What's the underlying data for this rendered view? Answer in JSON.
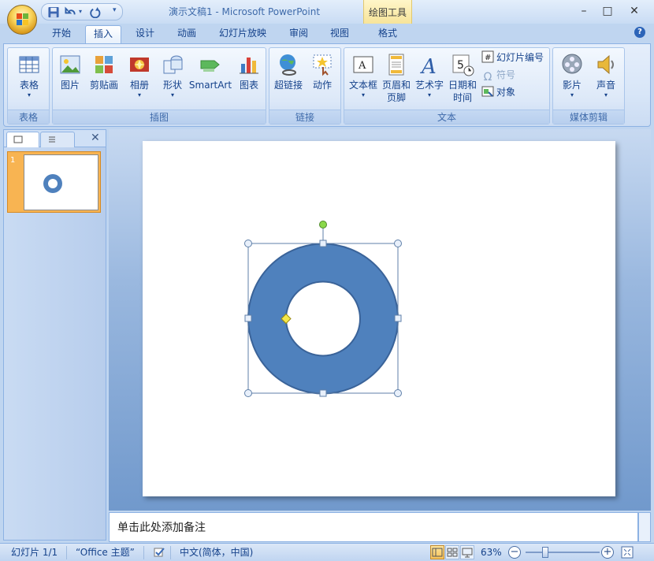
{
  "window": {
    "title": "演示文稿1 - Microsoft PowerPoint",
    "contextual_tab_group": "绘图工具",
    "controls": {
      "minimize": "–",
      "maximize": "□",
      "close": "✕"
    }
  },
  "tabs": [
    {
      "label": "开始",
      "active": false
    },
    {
      "label": "插入",
      "active": true
    },
    {
      "label": "设计",
      "active": false
    },
    {
      "label": "动画",
      "active": false
    },
    {
      "label": "幻灯片放映",
      "active": false
    },
    {
      "label": "审阅",
      "active": false
    },
    {
      "label": "视图",
      "active": false
    },
    {
      "label": "格式",
      "active": false
    }
  ],
  "ribbon": {
    "groups": {
      "table": {
        "label": "表格",
        "buttons": {
          "table": "表格"
        }
      },
      "illustrations": {
        "label": "插图",
        "buttons": {
          "picture": "图片",
          "clipart": "剪贴画",
          "album": "相册",
          "shapes": "形状",
          "smartart": "SmartArt",
          "chart": "图表"
        }
      },
      "links": {
        "label": "链接",
        "buttons": {
          "hyperlink": "超链接",
          "action": "动作"
        }
      },
      "text": {
        "label": "文本",
        "buttons": {
          "textbox": "文本框",
          "header_footer_1": "页眉和",
          "header_footer_2": "页脚",
          "wordart": "艺术字",
          "datetime_1": "日期和",
          "datetime_2": "时间",
          "slide_number": "幻灯片编号",
          "symbol": "符号",
          "object": "对象"
        }
      },
      "media": {
        "label": "媒体剪辑",
        "buttons": {
          "movie": "影片",
          "sound": "声音"
        }
      }
    }
  },
  "left_pane": {
    "close": "✕",
    "slides": [
      {
        "number": "1"
      }
    ]
  },
  "shape": {
    "type": "donut",
    "fill": "#4f81bd",
    "stroke": "#3a6399"
  },
  "notes": {
    "placeholder": "单击此处添加备注"
  },
  "status_bar": {
    "slide_info": "幻灯片 1/1",
    "theme": "“Office 主题”",
    "language": "中文(简体，中国)",
    "zoom": "63%",
    "zoom_level_percent": 63
  },
  "colors": {
    "accent_blue": "#4f81bd",
    "ribbon_text": "#15428b",
    "thumb_selected": "#f8b452"
  }
}
